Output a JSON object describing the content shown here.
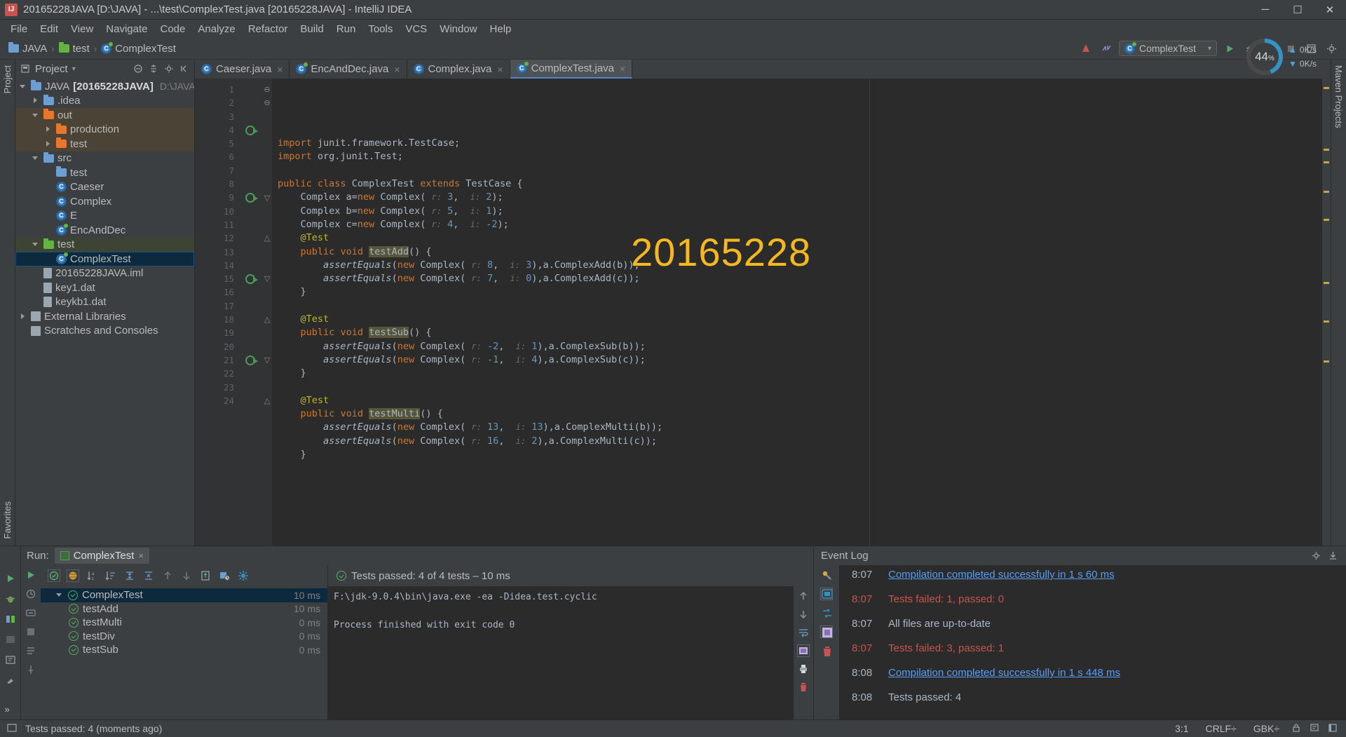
{
  "window": {
    "title": "20165228JAVA [D:\\JAVA] - ...\\test\\ComplexTest.java [20165228JAVA] - IntelliJ IDEA",
    "app_icon": "IJ",
    "minimize": "─",
    "maximize": "☐",
    "close": "✕"
  },
  "menu": [
    "File",
    "Edit",
    "View",
    "Navigate",
    "Code",
    "Analyze",
    "Refactor",
    "Build",
    "Run",
    "Tools",
    "VCS",
    "Window",
    "Help"
  ],
  "navbar": {
    "crumbs": [
      "JAVA",
      "test",
      "ComplexTest"
    ],
    "separator": "›",
    "run_config": "ComplexTest",
    "dropdown_caret": "▾"
  },
  "project_panel": {
    "title": "Project",
    "caret": "▾",
    "tree": [
      {
        "label": "JAVA",
        "bold_suffix": "[20165228JAVA]",
        "path": "D:\\JAVA",
        "indent": 0,
        "arrow": "down",
        "icon": "folder-module"
      },
      {
        "label": ".idea",
        "indent": 1,
        "arrow": "right",
        "icon": "folder-blue"
      },
      {
        "label": "out",
        "indent": 1,
        "arrow": "down",
        "icon": "folder-orange",
        "highlight": "out"
      },
      {
        "label": "production",
        "indent": 2,
        "arrow": "right",
        "icon": "folder-orange",
        "highlight": "out"
      },
      {
        "label": "test",
        "indent": 2,
        "arrow": "right",
        "icon": "folder-orange",
        "highlight": "out"
      },
      {
        "label": "src",
        "indent": 1,
        "arrow": "down",
        "icon": "folder-blue"
      },
      {
        "label": "test",
        "indent": 2,
        "arrow": "none",
        "icon": "folder-blue"
      },
      {
        "label": "Caeser",
        "indent": 2,
        "arrow": "none",
        "icon": "class"
      },
      {
        "label": "Complex",
        "indent": 2,
        "arrow": "none",
        "icon": "class"
      },
      {
        "label": "E",
        "indent": 2,
        "arrow": "none",
        "icon": "class"
      },
      {
        "label": "EncAndDec",
        "indent": 2,
        "arrow": "none",
        "icon": "class-test"
      },
      {
        "label": "test",
        "indent": 1,
        "arrow": "down",
        "icon": "folder-green",
        "highlight": "test"
      },
      {
        "label": "ComplexTest",
        "indent": 2,
        "arrow": "none",
        "icon": "class-test",
        "selected": true
      },
      {
        "label": "20165228JAVA.iml",
        "indent": 1,
        "arrow": "none",
        "icon": "file"
      },
      {
        "label": "key1.dat",
        "indent": 1,
        "arrow": "none",
        "icon": "file"
      },
      {
        "label": "keykb1.dat",
        "indent": 1,
        "arrow": "none",
        "icon": "file"
      },
      {
        "label": "External Libraries",
        "indent": 0,
        "arrow": "right",
        "icon": "library"
      },
      {
        "label": "Scratches and Consoles",
        "indent": 0,
        "arrow": "none",
        "icon": "library"
      }
    ]
  },
  "editor": {
    "tabs": [
      {
        "label": "Caeser.java",
        "icon": "class",
        "active": false
      },
      {
        "label": "EncAndDec.java",
        "icon": "class-test",
        "active": false
      },
      {
        "label": "Complex.java",
        "icon": "class",
        "active": false
      },
      {
        "label": "ComplexTest.java",
        "icon": "class-test",
        "active": true
      }
    ],
    "close_glyph": "×",
    "watermark": "20165228",
    "lines": [
      {
        "n": 1,
        "text": "import junit.framework.TestCase;"
      },
      {
        "n": 2,
        "text": "import org.junit.Test;"
      },
      {
        "n": 3,
        "text": ""
      },
      {
        "n": 4,
        "text": "public class ComplexTest extends TestCase {"
      },
      {
        "n": 5,
        "text": "    Complex a=new Complex( r: 3,  i: 2);"
      },
      {
        "n": 6,
        "text": "    Complex b=new Complex( r: 5,  i: 1);"
      },
      {
        "n": 7,
        "text": "    Complex c=new Complex( r: 4,  i: -2);"
      },
      {
        "n": 8,
        "text": "    @Test"
      },
      {
        "n": 9,
        "text": "    public void testAdd() {"
      },
      {
        "n": 10,
        "text": "        assertEquals(new Complex( r: 8,  i: 3),a.ComplexAdd(b));"
      },
      {
        "n": 11,
        "text": "        assertEquals(new Complex( r: 7,  i: 0),a.ComplexAdd(c));"
      },
      {
        "n": 12,
        "text": "    }"
      },
      {
        "n": 13,
        "text": ""
      },
      {
        "n": 14,
        "text": "    @Test"
      },
      {
        "n": 15,
        "text": "    public void testSub() {"
      },
      {
        "n": 16,
        "text": "        assertEquals(new Complex( r: -2,  i: 1),a.ComplexSub(b));"
      },
      {
        "n": 17,
        "text": "        assertEquals(new Complex( r: -1,  i: 4),a.ComplexSub(c));"
      },
      {
        "n": 18,
        "text": "    }"
      },
      {
        "n": 19,
        "text": ""
      },
      {
        "n": 20,
        "text": "    @Test"
      },
      {
        "n": 21,
        "text": "    public void testMulti() {"
      },
      {
        "n": 22,
        "text": "        assertEquals(new Complex( r: 13,  i: 13),a.ComplexMulti(b));"
      },
      {
        "n": 23,
        "text": "        assertEquals(new Complex( r: 16,  i: 2),a.ComplexMulti(c));"
      },
      {
        "n": 24,
        "text": "    }"
      }
    ]
  },
  "run_panel": {
    "label": "Run:",
    "tab": "ComplexTest",
    "close_glyph": "×",
    "status_text": "Tests passed: 4 of 4 tests – 10 ms",
    "tree": [
      {
        "label": "ComplexTest",
        "time": "10 ms",
        "root": true,
        "selected": true
      },
      {
        "label": "testAdd",
        "time": "10 ms"
      },
      {
        "label": "testMulti",
        "time": "0 ms"
      },
      {
        "label": "testDiv",
        "time": "0 ms"
      },
      {
        "label": "testSub",
        "time": "0 ms"
      }
    ],
    "console": "F:\\jdk-9.0.4\\bin\\java.exe -ea -Didea.test.cyclic\n\nProcess finished with exit code 0"
  },
  "event_log": {
    "title": "Event Log",
    "entries": [
      {
        "time": "8:07",
        "message": "Compilation completed successfully in 1 s 60 ms",
        "style": "link"
      },
      {
        "time": "8:07",
        "message": "Tests failed: 1, passed: 0",
        "style": "error"
      },
      {
        "time": "8:07",
        "message": "All files are up-to-date",
        "style": "normal"
      },
      {
        "time": "8:07",
        "message": "Tests failed: 3, passed: 1",
        "style": "error"
      },
      {
        "time": "8:08",
        "message": "Compilation completed successfully in 1 s 448 ms",
        "style": "link"
      },
      {
        "time": "8:08",
        "message": "Tests passed: 4",
        "style": "normal"
      }
    ]
  },
  "cpu_widget": {
    "value": "44",
    "unit": "%",
    "up": "0K/s",
    "down": "0K/s"
  },
  "status_bar": {
    "message": "Tests passed: 4 (moments ago)",
    "caret": "3:1",
    "line_sep": "CRLF÷",
    "encoding": "GBK÷"
  },
  "tool_strips": {
    "left_top": "Project",
    "left_bottom": "Favorites",
    "right": "Maven Projects",
    "bottom_left": "Run",
    "overflow": "»"
  },
  "colors": {
    "accent_blue": "#4a88c7",
    "selection": "#0d293e",
    "green_ok": "#59a869",
    "red_error": "#c75450",
    "watermark": "#f5b820"
  }
}
